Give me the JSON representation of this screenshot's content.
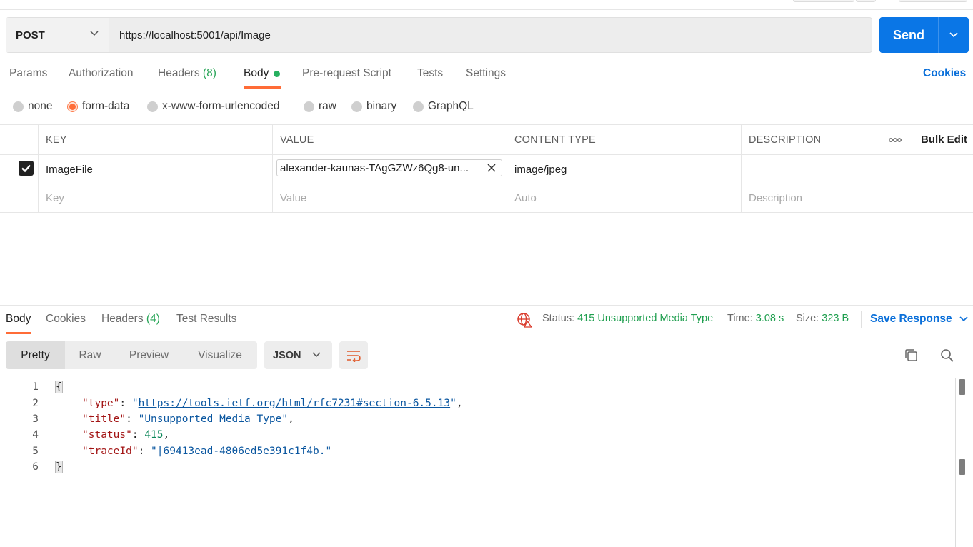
{
  "request": {
    "method": "POST",
    "url": "https://localhost:5001/api/Image",
    "send_label": "Send"
  },
  "request_tabs": {
    "params": "Params",
    "authorization": "Authorization",
    "headers_label": "Headers",
    "headers_count": "(8)",
    "body": "Body",
    "prerequest": "Pre-request Script",
    "tests": "Tests",
    "settings": "Settings",
    "cookies": "Cookies",
    "active": "Body",
    "active_indicator_color": "#ff6c37"
  },
  "body_modes": {
    "none": "none",
    "form_data": "form-data",
    "urlencoded": "x-www-form-urlencoded",
    "raw": "raw",
    "binary": "binary",
    "graphql": "GraphQL",
    "selected": "form-data"
  },
  "form_table": {
    "headers": {
      "key": "KEY",
      "value": "VALUE",
      "content_type": "CONTENT TYPE",
      "description": "DESCRIPTION",
      "more": "ooo",
      "bulk_edit": "Bulk Edit"
    },
    "rows": [
      {
        "checked": true,
        "key": "ImageFile",
        "value": "alexander-kaunas-TAgGZWz6Qg8-un...",
        "content_type": "image/jpeg",
        "description": ""
      }
    ],
    "placeholders": {
      "key": "Key",
      "value": "Value",
      "content_type": "Auto",
      "description": "Description"
    }
  },
  "response": {
    "tabs": {
      "body": "Body",
      "cookies": "Cookies",
      "headers_label": "Headers",
      "headers_count": "(4)",
      "test_results": "Test Results"
    },
    "status_label": "Status:",
    "status_value": "415 Unsupported Media Type",
    "time_label": "Time:",
    "time_value": "3.08 s",
    "size_label": "Size:",
    "size_value": "323 B",
    "save_response": "Save Response",
    "status_color": "#1f9f4f"
  },
  "viewer": {
    "modes": [
      "Pretty",
      "Raw",
      "Preview",
      "Visualize"
    ],
    "active_mode": "Pretty",
    "format": "JSON"
  },
  "code": {
    "line_numbers": [
      "1",
      "2",
      "3",
      "4",
      "5",
      "6"
    ],
    "open_brace": "{",
    "close_brace": "}",
    "quote": "\"",
    "colon": ": ",
    "comma": ",",
    "fields": [
      {
        "key": "type",
        "value": "https://tools.ietf.org/html/rfc7231#section-6.5.13",
        "kind": "link"
      },
      {
        "key": "title",
        "value": "Unsupported Media Type",
        "kind": "string"
      },
      {
        "key": "status",
        "value": "415",
        "kind": "number"
      },
      {
        "key": "traceId",
        "value": "|69413ead-4806ed5e391c1f4b.",
        "kind": "string"
      }
    ]
  }
}
